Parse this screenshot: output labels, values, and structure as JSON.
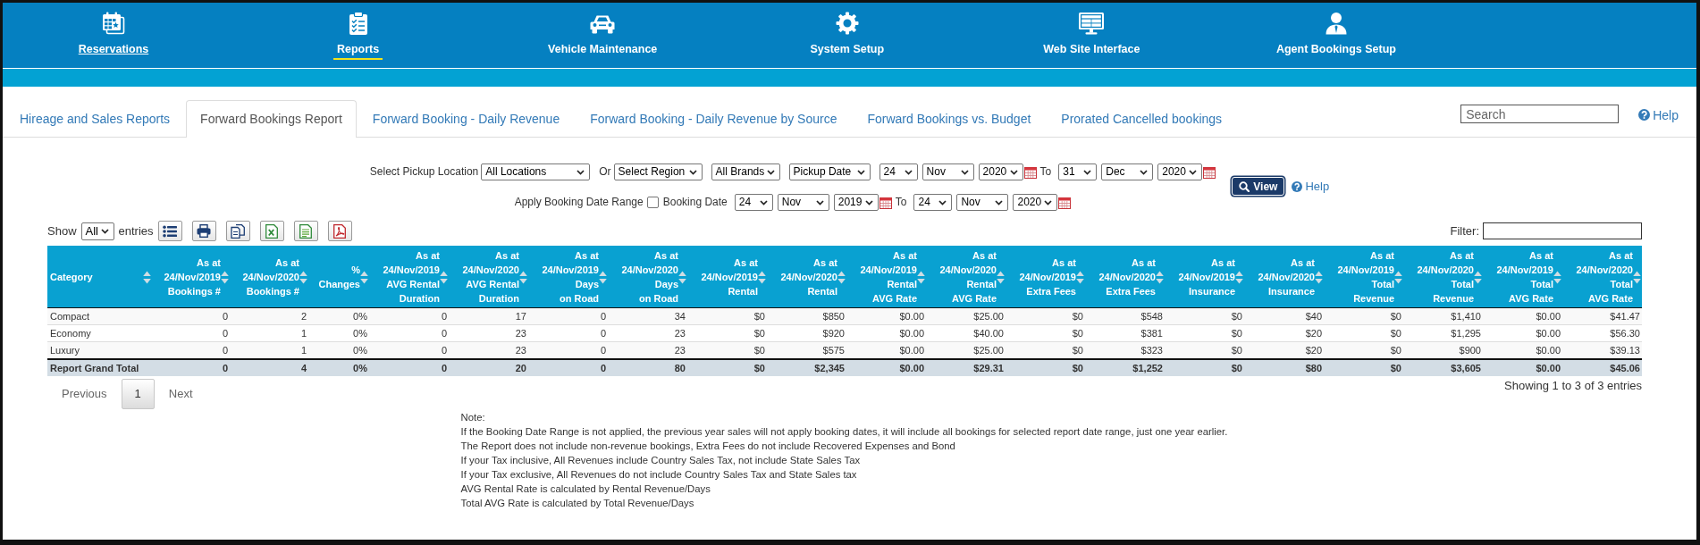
{
  "nav": {
    "items": [
      {
        "label": "Reservations",
        "selected": false,
        "underlined": true
      },
      {
        "label": "Reports",
        "selected": true,
        "underlined": false
      },
      {
        "label": "Vehicle Maintenance",
        "selected": false,
        "underlined": false
      },
      {
        "label": "System Setup",
        "selected": false,
        "underlined": false
      },
      {
        "label": "Web Site Interface",
        "selected": false,
        "underlined": false
      },
      {
        "label": "Agent Bookings Setup",
        "selected": false,
        "underlined": false
      }
    ]
  },
  "tabs": [
    {
      "label": "Hireage and Sales Reports",
      "selected": false
    },
    {
      "label": "Forward Bookings Report",
      "selected": true
    },
    {
      "label": "Forward Booking - Daily Revenue",
      "selected": false
    },
    {
      "label": "Forward Booking - Daily Revenue by Source",
      "selected": false
    },
    {
      "label": "Forward Bookings vs. Budget",
      "selected": false
    },
    {
      "label": "Prorated Cancelled bookings",
      "selected": false
    }
  ],
  "search": {
    "placeholder": "Search"
  },
  "help": {
    "label": "Help"
  },
  "filters": {
    "lines": [
      {
        "items": [
          {
            "kind": "label",
            "text": "Select Pickup Location"
          },
          {
            "kind": "select",
            "value": "All Locations"
          },
          {
            "kind": "label",
            "text": "Or"
          },
          {
            "kind": "select",
            "value": "Select Region"
          },
          {
            "kind": "select",
            "value": "All Brands"
          },
          {
            "kind": "select",
            "value": "Pickup Date"
          },
          {
            "kind": "date",
            "day": "24",
            "month": "Nov",
            "year": "2020"
          },
          {
            "kind": "label",
            "text": "To"
          },
          {
            "kind": "date",
            "day": "31",
            "month": "Dec",
            "year": "2020"
          }
        ]
      },
      {
        "items": [
          {
            "kind": "label",
            "text": "Apply Booking Date Range"
          },
          {
            "kind": "checkbox",
            "checked": false
          },
          {
            "kind": "label",
            "text": "Booking Date"
          },
          {
            "kind": "date",
            "day": "24",
            "month": "Nov",
            "year": "2019"
          },
          {
            "kind": "label",
            "text": "To"
          },
          {
            "kind": "date",
            "day": "24",
            "month": "Nov",
            "year": "2020"
          }
        ]
      }
    ],
    "view_button": {
      "label": "View"
    },
    "help": {
      "label": "Help"
    }
  },
  "table_controls": {
    "show_label": "Show",
    "page_length": "All",
    "entries_label": "entries",
    "filter": {
      "label": "Filter:"
    }
  },
  "table": {
    "columns": [
      "Category",
      "As at\n24/Nov/2019\nBookings #",
      "As at\n24/Nov/2020\nBookings #",
      "%\nChanges",
      "As at\n24/Nov/2019\nAVG Rental\nDuration",
      "As at\n24/Nov/2020\nAVG Rental\nDuration",
      "As at\n24/Nov/2019\nDays\non Road",
      "As at\n24/Nov/2020\nDays\non Road",
      "As at\n24/Nov/2019\nRental",
      "As at\n24/Nov/2020\nRental",
      "As at\n24/Nov/2019\nRental\nAVG Rate",
      "As at\n24/Nov/2020\nRental\nAVG Rate",
      "As at\n24/Nov/2019\nExtra Fees",
      "As at\n24/Nov/2020\nExtra Fees",
      "As at\n24/Nov/2019\nInsurance",
      "As at\n24/Nov/2020\nInsurance",
      "As at\n24/Nov/2019\nTotal\nRevenue",
      "As at\n24/Nov/2020\nTotal\nRevenue",
      "As at\n24/Nov/2019\nTotal\nAVG Rate",
      "As at\n24/Nov/2020\nTotal\nAVG Rate"
    ],
    "rows": [
      {
        "cells": [
          "Compact",
          "0",
          "2",
          "0%",
          "0",
          "17",
          "0",
          "34",
          "$0",
          "$850",
          "$0.00",
          "$25.00",
          "$0",
          "$548",
          "$0",
          "$40",
          "$0",
          "$1,410",
          "$0.00",
          "$41.47"
        ]
      },
      {
        "cells": [
          "Economy",
          "0",
          "1",
          "0%",
          "0",
          "23",
          "0",
          "23",
          "$0",
          "$920",
          "$0.00",
          "$40.00",
          "$0",
          "$381",
          "$0",
          "$20",
          "$0",
          "$1,295",
          "$0.00",
          "$56.30"
        ]
      },
      {
        "cells": [
          "Luxury",
          "0",
          "1",
          "0%",
          "0",
          "23",
          "0",
          "23",
          "$0",
          "$575",
          "$0.00",
          "$25.00",
          "$0",
          "$323",
          "$0",
          "$20",
          "$0",
          "$900",
          "$0.00",
          "$39.13"
        ]
      }
    ],
    "total": {
      "cells": [
        "Report Grand Total",
        "0",
        "4",
        "0%",
        "0",
        "20",
        "0",
        "80",
        "$0",
        "$2,345",
        "$0.00",
        "$29.31",
        "$0",
        "$1,252",
        "$0",
        "$80",
        "$0",
        "$3,605",
        "$0.00",
        "$45.06"
      ]
    }
  },
  "pagination": {
    "previous": {
      "label": "Previous",
      "disabled": true
    },
    "pages": [
      {
        "label": "1",
        "selected": true
      }
    ],
    "next": {
      "label": "Next",
      "disabled": true
    },
    "info": "Showing 1 to 3 of 3 entries"
  },
  "notes": {
    "title": "Note:",
    "lines": [
      "If the Booking Date Range is not applied, the previous year sales will not apply booking dates, it will include all bookings for selected report date range, just one year earlier.",
      "The Report does not include non-revenue bookings, Extra Fees do not include Recovered Expenses and Bond",
      "If your Tax inclusive, All Revenues include Country Sales Tax, not include State Sales Tax",
      "If your Tax exclusive, All Revenues do not include Country Sales Tax and State Sales tax",
      "AVG Rental Rate is calculated by Rental Revenue/Days",
      "Total AVG Rate is calculated by Total Revenue/Days"
    ]
  }
}
